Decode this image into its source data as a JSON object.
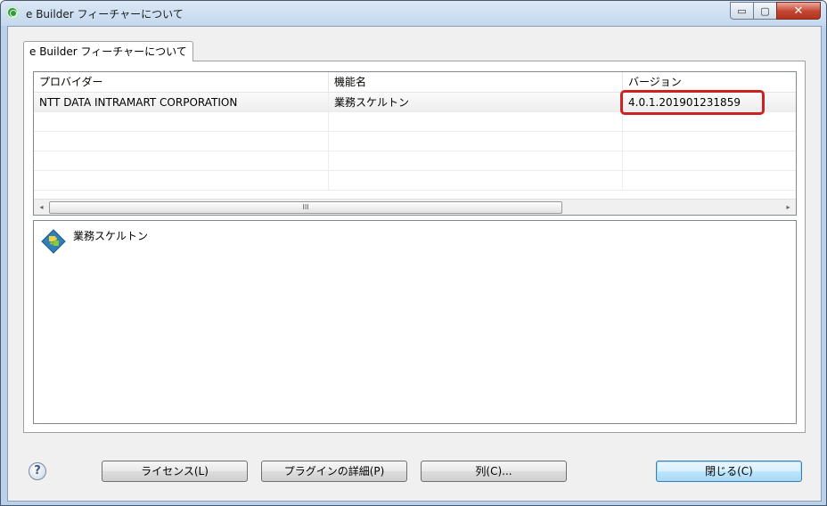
{
  "window": {
    "title": "e Builder フィーチャーについて",
    "controls": {
      "minimize": "▭",
      "maximize": "▢",
      "close": "✕"
    }
  },
  "tab": {
    "label": "e Builder フィーチャーについて"
  },
  "table": {
    "columns": [
      "プロバイダー",
      "機能名",
      "バージョン"
    ],
    "rows": [
      [
        "NTT DATA INTRAMART CORPORATION",
        "業務スケルトン",
        "4.0.1.201901231859"
      ]
    ],
    "empty_rows": 4,
    "scrollbar": {
      "grip": "III",
      "left_arrow": "◂",
      "right_arrow": "▸"
    }
  },
  "detail": {
    "feature_name": "業務スケルトン",
    "icon": "puzzle-feature-icon"
  },
  "buttons": {
    "help": "?",
    "license": "ライセンス(L)",
    "plugin_details": "プラグインの詳細(P)",
    "columns": "列(C)...",
    "close": "閉じる(C)"
  },
  "colors": {
    "highlight": "#cc2222",
    "default_button": "#3c7fb1"
  }
}
